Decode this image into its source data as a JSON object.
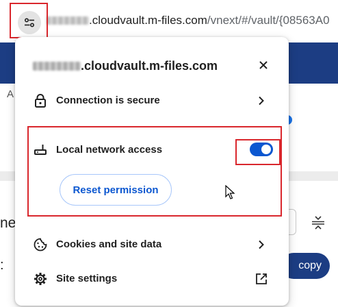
{
  "browser": {
    "url_host": ".cloudvault.m-files.com",
    "url_path": "/vnext/#/vault/{08563A0",
    "site_info_icon": "tune-icon"
  },
  "background": {
    "partial_a": "A",
    "partial_ne": "ne",
    "partial_colon": ":",
    "copy_button": "copy"
  },
  "popup": {
    "host": ".cloudvault.m-files.com",
    "connection_label": "Connection is secure",
    "local_network_label": "Local network access",
    "local_network_enabled": true,
    "reset_permission_label": "Reset permission",
    "cookies_label": "Cookies and site data",
    "site_settings_label": "Site settings"
  },
  "colors": {
    "accent": "#0b57d0",
    "highlight": "#d9262c"
  }
}
